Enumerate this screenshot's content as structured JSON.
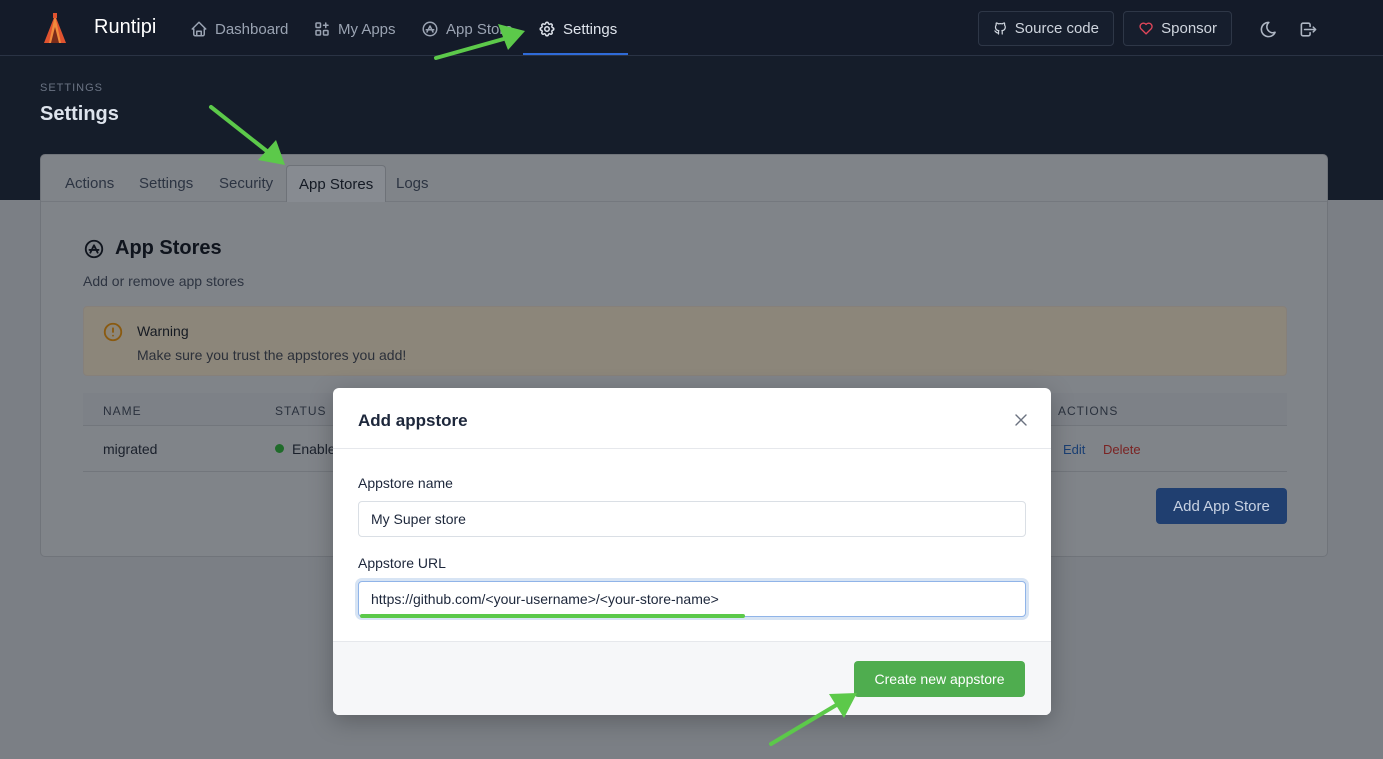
{
  "navbar": {
    "brand": "Runtipi",
    "items": [
      {
        "label": "Dashboard",
        "icon": "home-icon"
      },
      {
        "label": "My Apps",
        "icon": "apps-icon"
      },
      {
        "label": "App Store",
        "icon": "app-store-icon"
      },
      {
        "label": "Settings",
        "icon": "settings-icon"
      }
    ],
    "active_item": "Settings",
    "source_code_label": "Source code",
    "sponsor_label": "Sponsor",
    "theme_toggle_icon": "moon-icon",
    "logout_icon": "logout-icon"
  },
  "header": {
    "pretitle": "SETTINGS",
    "title": "Settings"
  },
  "tabs": [
    {
      "label": "Actions"
    },
    {
      "label": "Settings"
    },
    {
      "label": "Security"
    },
    {
      "label": "App Stores"
    },
    {
      "label": "Logs"
    }
  ],
  "active_tab": "App Stores",
  "section": {
    "title": "App Stores",
    "subtitle": "Add or remove app stores",
    "icon": "app-store-icon"
  },
  "alert": {
    "title": "Warning",
    "text": "Make sure you trust the appstores you add!"
  },
  "table": {
    "columns": [
      "NAME",
      "STATUS",
      "ACTIONS"
    ],
    "rows": [
      {
        "name": "migrated",
        "status": "Enable",
        "edit_label": "Edit",
        "delete_label": "Delete"
      }
    ]
  },
  "add_store_button": "Add App Store",
  "modal": {
    "title": "Add appstore",
    "name_label": "Appstore name",
    "name_value": "My Super store",
    "url_label": "Appstore URL",
    "url_value": "https://github.com/<your-username>/<your-store-name>",
    "submit_label": "Create new appstore"
  },
  "colors": {
    "navbar_bg": "#141b29",
    "primary": "#206bc4",
    "success": "#4fad4f",
    "danger": "#d63939",
    "annotation_arrow": "#5cc94a",
    "warning": "#f59f00"
  }
}
